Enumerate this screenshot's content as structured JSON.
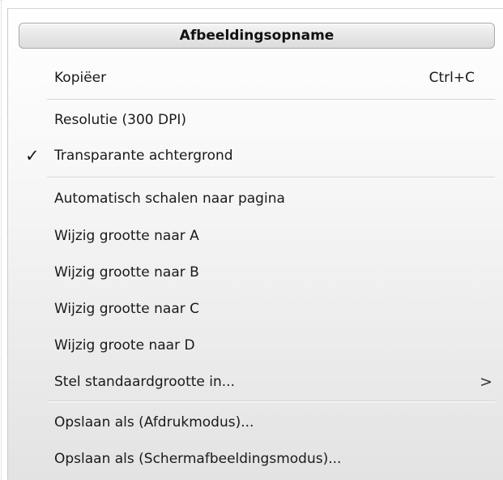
{
  "menu": {
    "title": "Afbeeldingsopname",
    "items": [
      {
        "label": "Kopiëer",
        "shortcut": "Ctrl+C"
      },
      {
        "label": "Resolutie (300 DPI)"
      },
      {
        "label": "Transparante achtergrond",
        "checked": true
      },
      {
        "label": "Automatisch schalen naar pagina"
      },
      {
        "label": "Wijzig grootte naar A"
      },
      {
        "label": "Wijzig grootte naar B"
      },
      {
        "label": "Wijzig grootte naar C"
      },
      {
        "label": "Wijzig groote naar D"
      },
      {
        "label": "Stel standaardgrootte in...",
        "has_submenu": true
      },
      {
        "label": "Opslaan als (Afdrukmodus)..."
      },
      {
        "label": "Opslaan als (Schermafbeeldingsmodus)..."
      }
    ]
  },
  "icons": {
    "checkmark": "✓",
    "submenu_arrow": ">"
  }
}
